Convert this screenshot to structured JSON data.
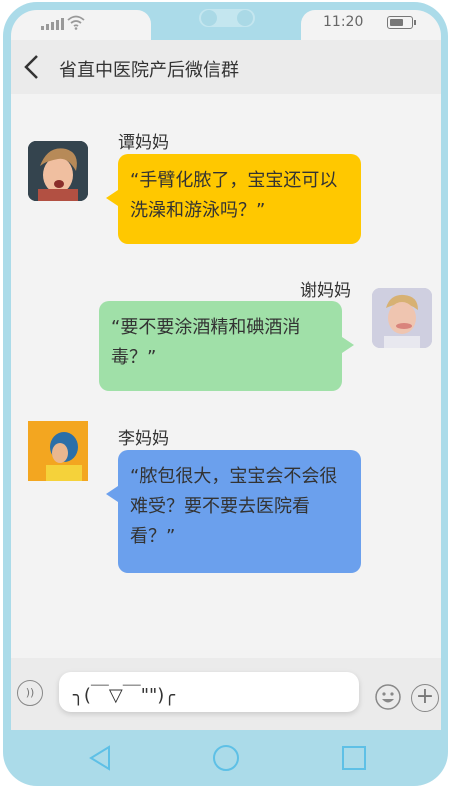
{
  "status": {
    "time": "11:20"
  },
  "header": {
    "title": "省直中医院产后微信群"
  },
  "messages": [
    {
      "name": "谭妈妈",
      "text": "“手臂化脓了，宝宝还可以洗澡和游泳吗？”",
      "color": "#ffc800",
      "side": "left"
    },
    {
      "name": "谢妈妈",
      "text": "“要不要涂酒精和碘酒消毒？”",
      "color": "#a0e0a8",
      "side": "right"
    },
    {
      "name": "李妈妈",
      "text": "“脓包很大，宝宝会不会很难受？要不要去医院看看？”",
      "color": "#6ba0ed",
      "side": "left"
    }
  ],
  "input": {
    "text": "╮(￣▽￣\"\")╭"
  },
  "icons": {
    "voice": "voice-icon",
    "emoji": "emoji-icon",
    "plus": "plus-icon",
    "back": "back-icon"
  }
}
